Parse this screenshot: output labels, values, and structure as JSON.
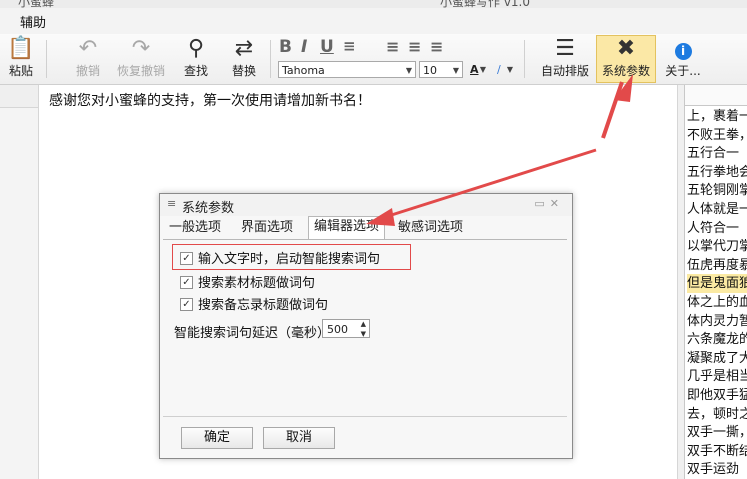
{
  "window": {
    "title_fragment_left": "小蜜蜂",
    "title_fragment_center": "小蜜蜂写作 v1.0"
  },
  "menu": {
    "items": [
      "辅助"
    ]
  },
  "toolbar": {
    "paste": "粘贴",
    "undo": "撤销",
    "redo": "恢复撤销",
    "find": "查找",
    "replace": "替换",
    "font_name": "Tahoma",
    "font_size": "10",
    "auto_layout": "自动排版",
    "sys_params": "系统参数",
    "about": "关于...",
    "icons": [
      "clipboard-icon",
      "undo-icon",
      "redo-icon",
      "search-icon",
      "replace-icon",
      "layout-icon",
      "tools-icon",
      "info-icon"
    ]
  },
  "editor": {
    "text": "感谢您对小蜜蜂的支持，第一次使用请增加新书名！"
  },
  "right_panel": {
    "lines": [
      "上，裹着一",
      "不败王拳，",
      "五行合一",
      "五行拳地会",
      "五轮铜刚掌",
      "人体就是一",
      "人符合一",
      "以掌代刀掌",
      "伍虎再度暴",
      "但是鬼面狼",
      "体之上的血",
      "体内灵力暂",
      "六条魔龙的",
      "凝聚成了大",
      "几乎是相当",
      "即他双手猛",
      "去，顿时之",
      "双手一撕，",
      "双手不断结",
      "双手运劲"
    ],
    "highlight_index": 9
  },
  "dialog": {
    "title": "系统参数",
    "tabs": [
      "一般选项",
      "界面选项",
      "编辑器选项",
      "敏感词选项"
    ],
    "active_tab": 2,
    "options": [
      {
        "label": "输入文字时，启动智能搜索词句",
        "checked": true
      },
      {
        "label": "搜索素材标题做词句",
        "checked": true
      },
      {
        "label": "搜索备忘录标题做词句",
        "checked": true
      }
    ],
    "delay_label": "智能搜索词句延迟（毫秒）",
    "delay_value": "500",
    "ok": "确定",
    "cancel": "取消"
  },
  "colors": {
    "annotation": "#e24a4a",
    "highlight_button": "#fbe8a6"
  }
}
